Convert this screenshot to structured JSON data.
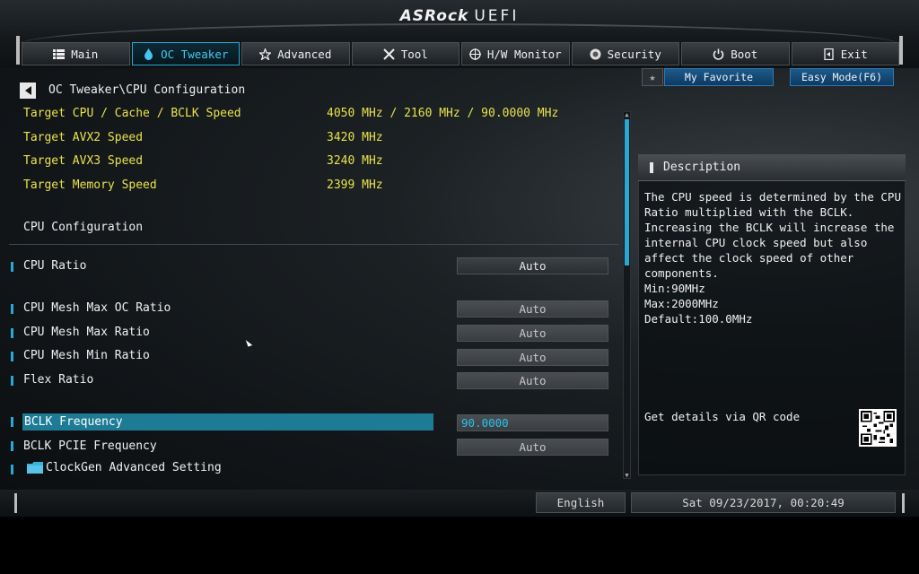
{
  "header": {
    "brand": "ASRock",
    "product": "UEFI",
    "tabs": [
      {
        "label": "Main",
        "icon": "list-icon",
        "active": false
      },
      {
        "label": "OC Tweaker",
        "icon": "flame-icon",
        "active": true
      },
      {
        "label": "Advanced",
        "icon": "star-icon",
        "active": false
      },
      {
        "label": "Tool",
        "icon": "tools-icon",
        "active": false
      },
      {
        "label": "H/W Monitor",
        "icon": "crosshair-icon",
        "active": false
      },
      {
        "label": "Security",
        "icon": "shield-icon",
        "active": false
      },
      {
        "label": "Boot",
        "icon": "power-icon",
        "active": false
      },
      {
        "label": "Exit",
        "icon": "exit-icon",
        "active": false
      }
    ]
  },
  "favorites": {
    "my_favorite": "My Favorite",
    "easy_mode": "Easy Mode(F6)"
  },
  "breadcrumb": "OC Tweaker\\CPU Configuration",
  "info_rows": [
    {
      "label": "Target CPU / Cache / BCLK Speed",
      "value": "4050 MHz / 2160 MHz / 90.0000 MHz"
    },
    {
      "label": "Target AVX2 Speed",
      "value": "3420 MHz"
    },
    {
      "label": "Target AVX3 Speed",
      "value": "3240 MHz"
    },
    {
      "label": "Target Memory Speed",
      "value": "2399 MHz"
    }
  ],
  "section_title": "CPU Configuration",
  "options": [
    {
      "label": "CPU Ratio",
      "value": "Auto"
    },
    {
      "label": "CPU Mesh Max OC Ratio",
      "value": "Auto"
    },
    {
      "label": "CPU Mesh Max Ratio",
      "value": "Auto"
    },
    {
      "label": "CPU Mesh Min Ratio",
      "value": "Auto"
    },
    {
      "label": "Flex Ratio",
      "value": "Auto"
    },
    {
      "label": "BCLK Frequency",
      "value": "90.0000"
    },
    {
      "label": "BCLK PCIE Frequency",
      "value": "Auto"
    },
    {
      "label": "ClockGen Advanced Setting",
      "value": ""
    }
  ],
  "description": {
    "title": "Description",
    "lines": [
      "The CPU speed is determined by the CPU",
      "Ratio multiplied with the BCLK.",
      "Increasing the BCLK will increase the",
      "internal CPU clock speed but also",
      "affect the clock speed of other",
      "components.",
      "Min:90MHz",
      "Max:2000MHz",
      "Default:100.0MHz"
    ],
    "qr_label": "Get details via QR code"
  },
  "footer": {
    "language": "English",
    "datetime": "Sat 09/23/2017, 00:20:49"
  },
  "colors": {
    "accent": "#2aa7d4",
    "info_text": "#e9e24c",
    "highlight": "#1d7b96"
  }
}
